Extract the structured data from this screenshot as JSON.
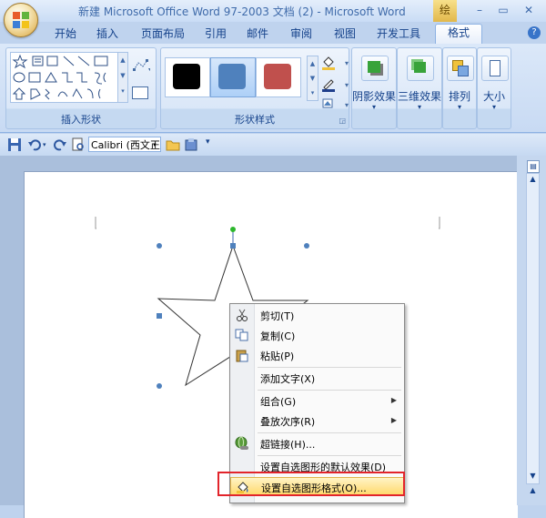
{
  "window": {
    "title": "新建 Microsoft Office Word 97-2003 文档 (2) - Microsoft Word",
    "context_tab_label": "绘",
    "buttons": {
      "minimize": "–",
      "restore": "▭",
      "close": "✕"
    }
  },
  "ribbon": {
    "tabs": [
      "开始",
      "插入",
      "页面布局",
      "引用",
      "邮件",
      "审阅",
      "视图",
      "开发工具",
      "格式"
    ],
    "active_tab": "格式",
    "help": "?",
    "groups": {
      "insert_shapes": {
        "label": "插入形状"
      },
      "shape_styles": {
        "label": "形状样式",
        "swatches": [
          "#000000",
          "#4f81bd",
          "#c0504d"
        ]
      },
      "shadow": {
        "label": "阴影效果"
      },
      "3d": {
        "label": "三维效果"
      },
      "arrange": {
        "label": "排列"
      },
      "size": {
        "label": "大小"
      }
    }
  },
  "qat": {
    "font": "Calibri (西文正文)"
  },
  "context_menu": {
    "items": [
      {
        "label": "剪切(T)",
        "icon": "scissors-icon"
      },
      {
        "label": "复制(C)",
        "icon": "copy-icon"
      },
      {
        "label": "粘贴(P)",
        "icon": "paste-icon"
      },
      {
        "label": "添加文字(X)",
        "icon": ""
      },
      {
        "label": "组合(G)",
        "icon": "",
        "submenu": true
      },
      {
        "label": "叠放次序(R)",
        "icon": "",
        "submenu": true
      },
      {
        "label": "超链接(H)...",
        "icon": "hyperlink-icon"
      },
      {
        "label": "设置自选图形的默认效果(D)",
        "icon": ""
      },
      {
        "label": "设置自选图形格式(O)...",
        "icon": "format-shape-icon"
      }
    ],
    "highlighted_index": 8
  },
  "colors": {
    "selection_handle": "#4f81bd",
    "rotate_handle": "#2cb72c",
    "highlight_border": "#e2242b"
  }
}
